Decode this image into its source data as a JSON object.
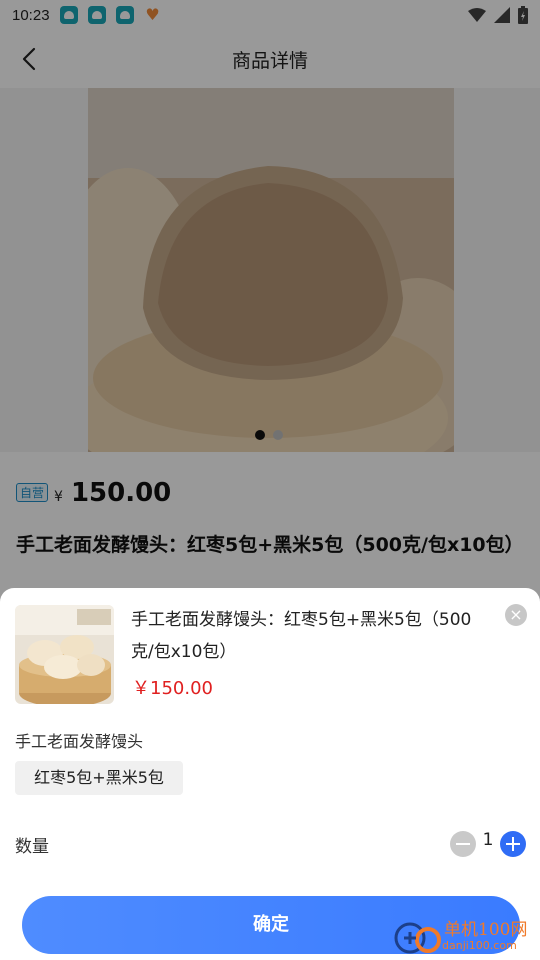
{
  "status": {
    "time": "10:23"
  },
  "header": {
    "title": "商品详情"
  },
  "product": {
    "self_tag": "自营",
    "currency": "¥",
    "price": "150.00",
    "title": "手工老面发酵馒头：红枣5包+黑米5包（500克/包x10包）"
  },
  "sheet": {
    "title": "手工老面发酵馒头：红枣5包+黑米5包（500克/包x10包）",
    "price": "￥150.00",
    "close": "×",
    "spec_group_label": "手工老面发酵馒头",
    "spec_option": "红枣5包+黑米5包",
    "qty_label": "数量",
    "qty_value": "1",
    "confirm_label": "确定"
  },
  "watermark": {
    "text": "单机100网",
    "sub": "danji100.com"
  },
  "colors": {
    "accent": "#3a7bff",
    "price_red": "#e02020",
    "tag_blue": "#1e8ec9"
  }
}
